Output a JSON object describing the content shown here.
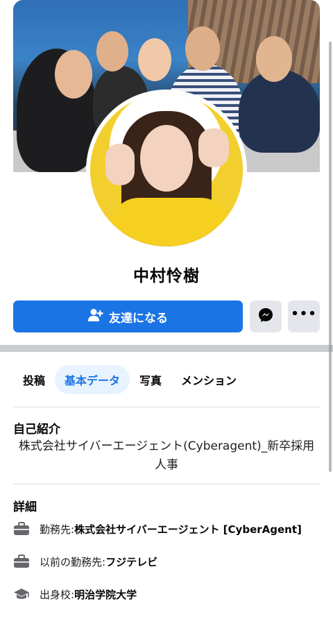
{
  "profile": {
    "name": "中村怜樹"
  },
  "actions": {
    "add_friend_label": "友達になる",
    "messenger_icon": "messenger-icon",
    "more_label": "•••"
  },
  "tabs": [
    {
      "label": "投稿",
      "active": false
    },
    {
      "label": "基本データ",
      "active": true
    },
    {
      "label": "写真",
      "active": false
    },
    {
      "label": "メンション",
      "active": false
    }
  ],
  "intro": {
    "title": "自己紹介",
    "text": "株式会社サイバーエージェント(Cyberagent)_新卒採用人事"
  },
  "details": {
    "title": "詳細",
    "items": [
      {
        "icon": "briefcase-icon",
        "label": "勤務先: ",
        "value": "株式会社サイバーエージェント [CyberAgent]"
      },
      {
        "icon": "briefcase-icon",
        "label": "以前の勤務先: ",
        "value": "フジテレビ"
      },
      {
        "icon": "graduation-cap-icon",
        "label": "出身校: ",
        "value": "明治学院大学"
      }
    ]
  },
  "colors": {
    "accent": "#1b74e4",
    "active_tab_bg": "#e7f3ff",
    "secondary_button": "#e4e6eb"
  }
}
